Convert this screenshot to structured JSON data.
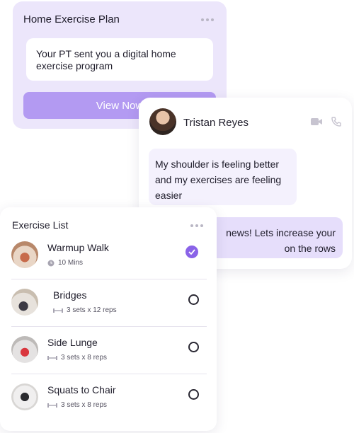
{
  "plan": {
    "title": "Home Exercise Plan",
    "message": "Your PT sent you a digital home exercise program",
    "button_label": "View Now"
  },
  "chat": {
    "contact_name": "Tristan Reyes",
    "incoming_message": "My shoulder is feeling better and my exercises are feeling easier",
    "outgoing_message": "news! Lets increase your on the rows"
  },
  "exercise_list": {
    "title": "Exercise List",
    "items": [
      {
        "name": "Warmup Walk",
        "meta": "10 Mins",
        "done": true,
        "meta_icon": "clock-icon"
      },
      {
        "name": "Bridges",
        "meta": "3 sets x 12 reps",
        "done": false,
        "meta_icon": "dumbbell-icon"
      },
      {
        "name": "Side Lunge",
        "meta": "3 sets x 8 reps",
        "done": false,
        "meta_icon": "dumbbell-icon"
      },
      {
        "name": "Squats to Chair",
        "meta": "3 sets x 8 reps",
        "done": false,
        "meta_icon": "dumbbell-icon"
      }
    ]
  },
  "colors": {
    "accent": "#8a63e8",
    "button": "#b39af2",
    "plan_bg": "#ece6fb"
  }
}
